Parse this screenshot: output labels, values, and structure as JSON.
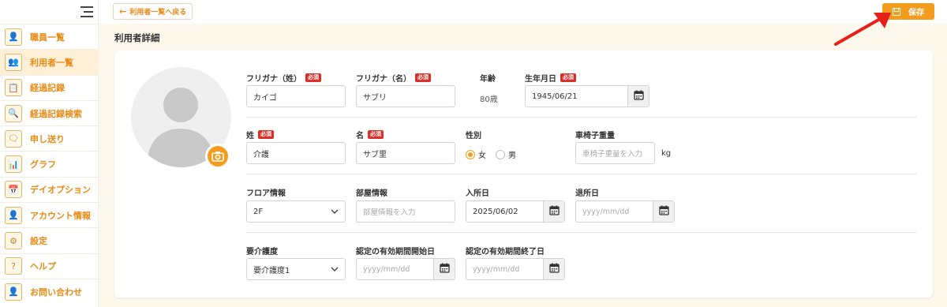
{
  "sidebar": {
    "items": [
      {
        "label": "職員一覧",
        "icon": "staff-icon",
        "glyph": "👤",
        "active": false
      },
      {
        "label": "利用者一覧",
        "icon": "users-icon",
        "glyph": "👥",
        "active": true
      },
      {
        "label": "経過記録",
        "icon": "clipboard-icon",
        "glyph": "📋",
        "active": false
      },
      {
        "label": "経過記録検索",
        "icon": "search-record-icon",
        "glyph": "🔍",
        "active": false
      },
      {
        "label": "申し送り",
        "icon": "handover-icon",
        "glyph": "🗨",
        "active": false
      },
      {
        "label": "グラフ",
        "icon": "chart-icon",
        "glyph": "📊",
        "active": false
      },
      {
        "label": "デイオプション",
        "icon": "calendar-option-icon",
        "glyph": "📅",
        "active": false
      },
      {
        "label": "アカウント情報",
        "icon": "account-icon",
        "glyph": "👤",
        "active": false
      },
      {
        "label": "設定",
        "icon": "settings-icon",
        "glyph": "⚙",
        "active": false
      },
      {
        "label": "ヘルプ",
        "icon": "help-icon",
        "glyph": "?",
        "active": false
      },
      {
        "label": "お問い合わせ",
        "icon": "contact-icon",
        "glyph": "👤",
        "active": false
      }
    ]
  },
  "topbar": {
    "back_label": "利用者一覧へ戻る",
    "save_label": "保存"
  },
  "page": {
    "title": "利用者詳細"
  },
  "form": {
    "required_badge": "必須",
    "kana_last": {
      "label": "フリガナ（姓）",
      "value": "カイゴ"
    },
    "kana_first": {
      "label": "フリガナ（名）",
      "value": "サブリ"
    },
    "age": {
      "label": "年齢",
      "value": "80歳"
    },
    "birthdate": {
      "label": "生年月日",
      "value": "1945/06/21"
    },
    "last_name": {
      "label": "姓",
      "value": "介護"
    },
    "first_name": {
      "label": "名",
      "value": "サブ里"
    },
    "gender": {
      "label": "性別",
      "options": [
        "女",
        "男"
      ],
      "selected": "女"
    },
    "wheelchair_weight": {
      "label": "車椅子重量",
      "placeholder": "車椅子重量を入力",
      "unit": "kg"
    },
    "floor": {
      "label": "フロア情報",
      "value": "2F"
    },
    "room": {
      "label": "部屋情報",
      "placeholder": "部屋情報を入力"
    },
    "admission_date": {
      "label": "入所日",
      "value": "2025/06/02"
    },
    "discharge_date": {
      "label": "退所日",
      "placeholder": "yyyy/mm/dd"
    },
    "care_level": {
      "label": "要介護度",
      "value": "要介護度1"
    },
    "cert_start": {
      "label": "認定の有効期間開始日",
      "placeholder": "yyyy/mm/dd"
    },
    "cert_end": {
      "label": "認定の有効期間終了日",
      "placeholder": "yyyy/mm/dd"
    }
  },
  "colors": {
    "accent": "#f39c1e",
    "required": "#d9302a",
    "annotation_arrow": "#e8201a"
  }
}
